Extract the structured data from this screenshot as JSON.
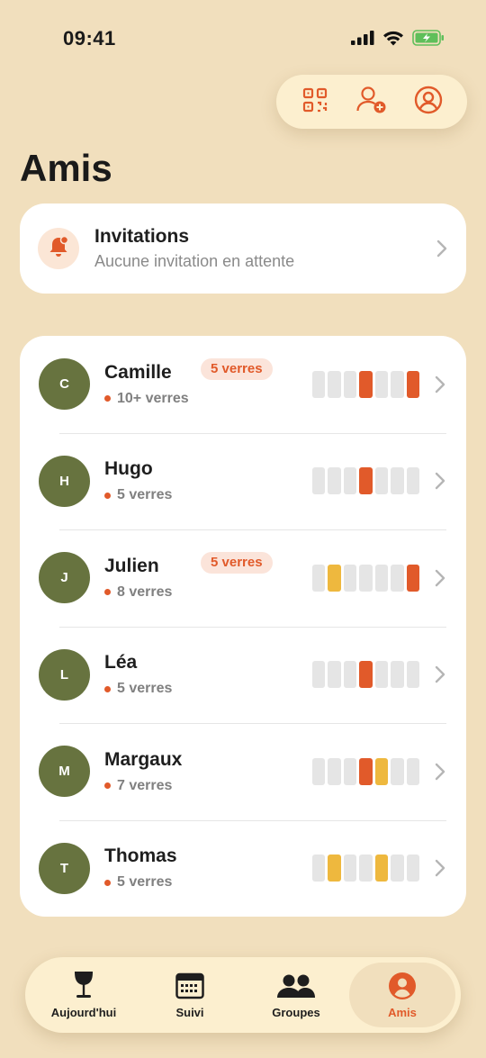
{
  "status_bar": {
    "time": "09:41"
  },
  "top_actions": [
    {
      "icon": "qr-code-icon"
    },
    {
      "icon": "add-friend-icon"
    },
    {
      "icon": "profile-icon"
    }
  ],
  "page": {
    "title": "Amis"
  },
  "invitations": {
    "title": "Invitations",
    "subtitle": "Aucune invitation en attente",
    "icon": "bell-icon"
  },
  "colors": {
    "accent": "#e15a2a",
    "yellow": "#eeb83e",
    "avatar": "#67733f",
    "background": "#f1dfbd"
  },
  "friends": [
    {
      "initial": "C",
      "name": "Camille",
      "count": "10+ verres",
      "badge": "5 verres",
      "week": [
        "empty",
        "empty",
        "empty",
        "red",
        "empty",
        "empty",
        "red"
      ]
    },
    {
      "initial": "H",
      "name": "Hugo",
      "count": "5 verres",
      "badge": "",
      "week": [
        "empty",
        "empty",
        "empty",
        "red",
        "empty",
        "empty",
        "empty"
      ]
    },
    {
      "initial": "J",
      "name": "Julien",
      "count": "8 verres",
      "badge": "5 verres",
      "week": [
        "empty",
        "yellow",
        "empty",
        "empty",
        "empty",
        "empty",
        "red"
      ]
    },
    {
      "initial": "L",
      "name": "Léa",
      "count": "5 verres",
      "badge": "",
      "week": [
        "empty",
        "empty",
        "empty",
        "red",
        "empty",
        "empty",
        "empty"
      ]
    },
    {
      "initial": "M",
      "name": "Margaux",
      "count": "7 verres",
      "badge": "",
      "week": [
        "empty",
        "empty",
        "empty",
        "red",
        "yellow",
        "empty",
        "empty"
      ]
    },
    {
      "initial": "T",
      "name": "Thomas",
      "count": "5 verres",
      "badge": "",
      "week": [
        "empty",
        "yellow",
        "empty",
        "empty",
        "yellow",
        "empty",
        "empty"
      ]
    }
  ],
  "tabs": [
    {
      "label": "Aujourd'hui",
      "icon": "wine-glass-icon",
      "active": false
    },
    {
      "label": "Suivi",
      "icon": "calendar-icon",
      "active": false
    },
    {
      "label": "Groupes",
      "icon": "group-icon",
      "active": false
    },
    {
      "label": "Amis",
      "icon": "profile-icon",
      "active": true
    }
  ]
}
